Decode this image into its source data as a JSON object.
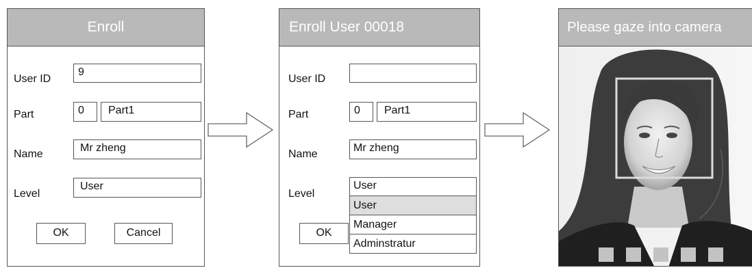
{
  "enroll_dialog": {
    "title": "Enroll",
    "fields": {
      "user_id": {
        "label": "User ID",
        "value": "9"
      },
      "part": {
        "label": "Part",
        "number": "0",
        "name": "Part1"
      },
      "name": {
        "label": "Name",
        "value": "Mr zheng"
      },
      "level": {
        "label": "Level",
        "value": "User"
      }
    },
    "ok_label": "OK",
    "cancel_label": "Cancel"
  },
  "enroll_user_dialog": {
    "title": "Enroll User 00018",
    "fields": {
      "user_id": {
        "label": "User ID",
        "value": ""
      },
      "part": {
        "label": "Part",
        "number": "0",
        "name": "Part1"
      },
      "name": {
        "label": "Name",
        "value": "Mr zheng"
      },
      "level": {
        "label": "Level",
        "value": "User"
      }
    },
    "level_options": [
      "User",
      "Manager",
      "Adminstratur"
    ],
    "selected_option": "User",
    "ok_label": "OK"
  },
  "camera_screen": {
    "title": "Please gaze into camera",
    "progress_total": 5,
    "progress_done": 0
  },
  "icons": [
    "right-arrow-icon",
    "right-arrow-icon"
  ],
  "colors": {
    "title_bar": "#b9b9b9",
    "title_text": "#ffffff",
    "border": "#555555",
    "highlight": "#dedede"
  }
}
